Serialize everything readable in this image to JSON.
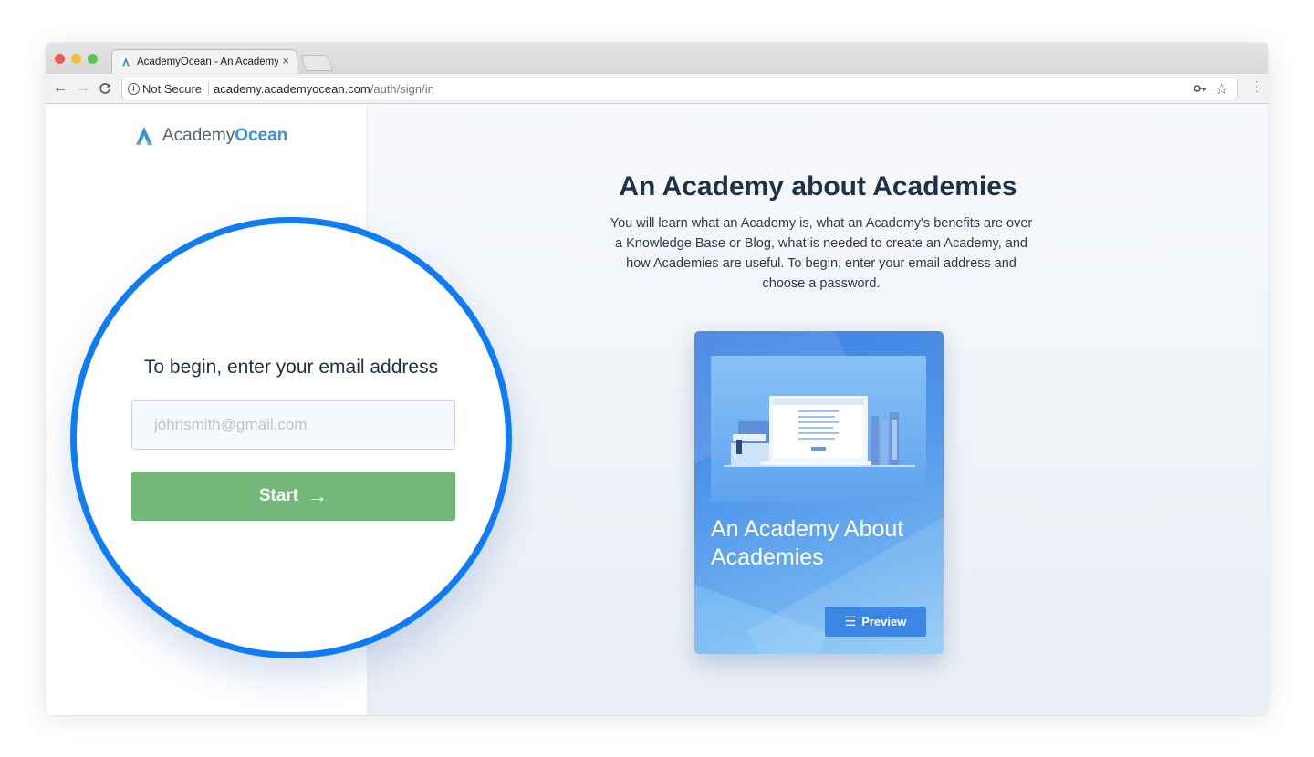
{
  "browser": {
    "tab_title": "AcademyOcean - An Academy",
    "tab_close": "×",
    "security_label": "Not Secure",
    "url_host": "academy.academyocean.com",
    "url_path": "/auth/sign/in",
    "nav": {
      "back": "←",
      "forward": "→",
      "reload": "C"
    },
    "icons": {
      "key": "key-icon",
      "star": "star-icon",
      "menu": "menu-icon"
    }
  },
  "logo": {
    "part1": "Academy",
    "part2": "Ocean"
  },
  "hero": {
    "title": "An Academy about Academies",
    "description": "You will learn what an Academy is, what an Academy's benefits are over a Knowledge Base or Blog, what is needed to create an Academy, and how Academies are useful. To begin, enter your email address and choose a password."
  },
  "card": {
    "title": "An Academy About Academies",
    "preview_label": "Preview"
  },
  "signin": {
    "prompt": "To begin, enter your email address",
    "email_placeholder": "johnsmith@gmail.com",
    "email_value": "",
    "start_label": "Start"
  },
  "colors": {
    "accent": "#0f7cf4",
    "logo_accent": "#3a8fe0",
    "start_button": "#72b879",
    "preview_button": "#3b86e4",
    "heading": "#1d3147"
  }
}
